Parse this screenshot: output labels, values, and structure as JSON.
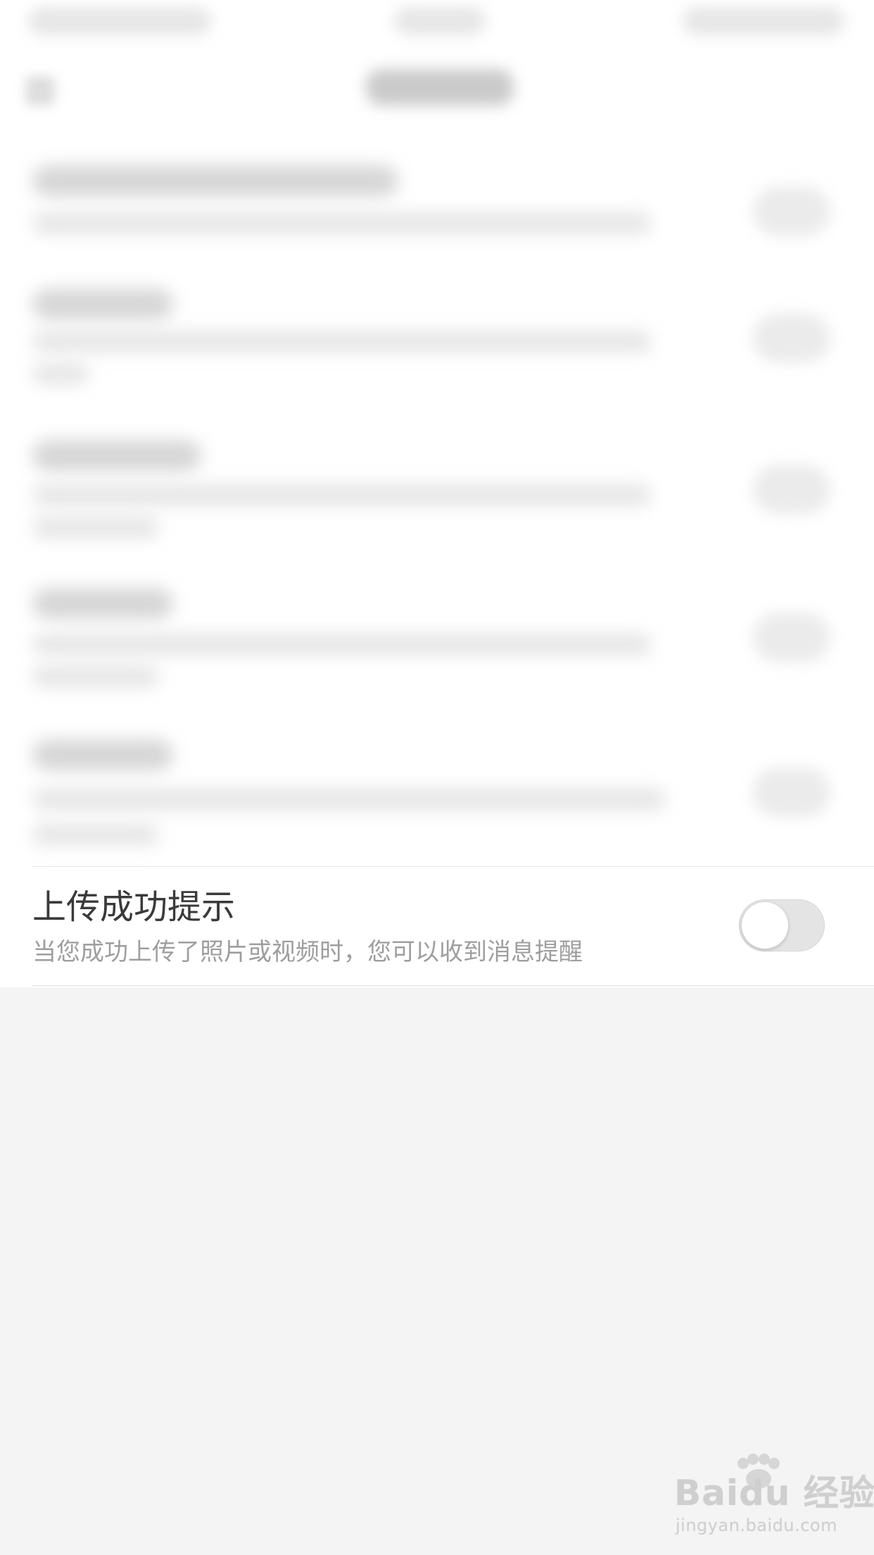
{
  "settings": {
    "upload_success": {
      "title": "上传成功提示",
      "description": "当您成功上传了照片或视频时，您可以收到消息提醒",
      "toggle_state": "off"
    }
  },
  "watermark": {
    "logo_text": "Baidu 经验",
    "sub_text": "jingyan.baidu.com"
  },
  "colors": {
    "page_background": "#f4f4f4",
    "panel_background": "#ffffff",
    "title_text": "#3a3a3a",
    "description_text": "#9e9e9e",
    "toggle_off_track": "#e4e4e4"
  },
  "icons": [
    "paw-icon",
    "toggle-knob"
  ]
}
